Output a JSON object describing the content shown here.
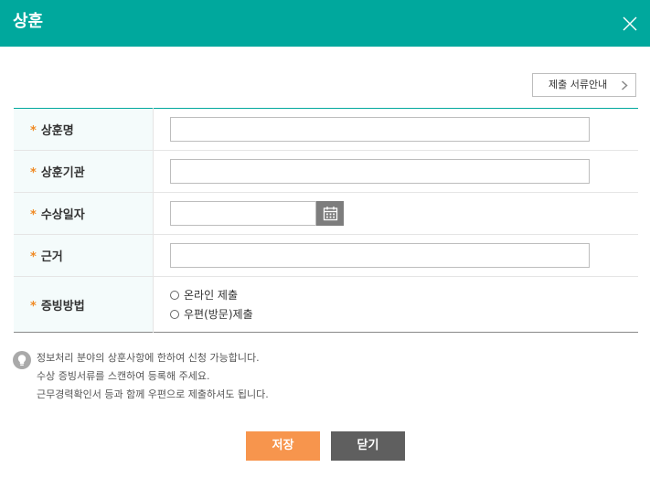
{
  "header": {
    "title": "상훈"
  },
  "guide_button": {
    "label": "제출 서류안내"
  },
  "form": {
    "required_mark": "*",
    "fields": [
      {
        "label": "상훈명",
        "value": ""
      },
      {
        "label": "상훈기관",
        "value": ""
      },
      {
        "label": "수상일자",
        "value": ""
      },
      {
        "label": "근거",
        "value": ""
      },
      {
        "label": "증빙방법"
      }
    ],
    "proof_options": [
      {
        "label": "온라인 제출",
        "selected": false
      },
      {
        "label": "우편(방문)제출",
        "selected": false
      }
    ]
  },
  "notice": {
    "lines": [
      "정보처리 분야의 상훈사항에 한하여 신청 가능합니다.",
      "수상 증빙서류를 스캔하여 등록해 주세요.",
      "근무경력확인서 등과 함께 우편으로 제출하셔도 됩니다."
    ]
  },
  "buttons": {
    "save": "저장",
    "close": "닫기"
  },
  "colors": {
    "header": "#00a89d",
    "required_mark": "#f08a24",
    "save_button": "#f7954d",
    "close_button": "#5f5f5f"
  },
  "icons": {
    "close": "close-icon",
    "chevron": "chevron-right-icon",
    "calendar": "calendar-icon",
    "notice": "lightbulb-icon"
  }
}
